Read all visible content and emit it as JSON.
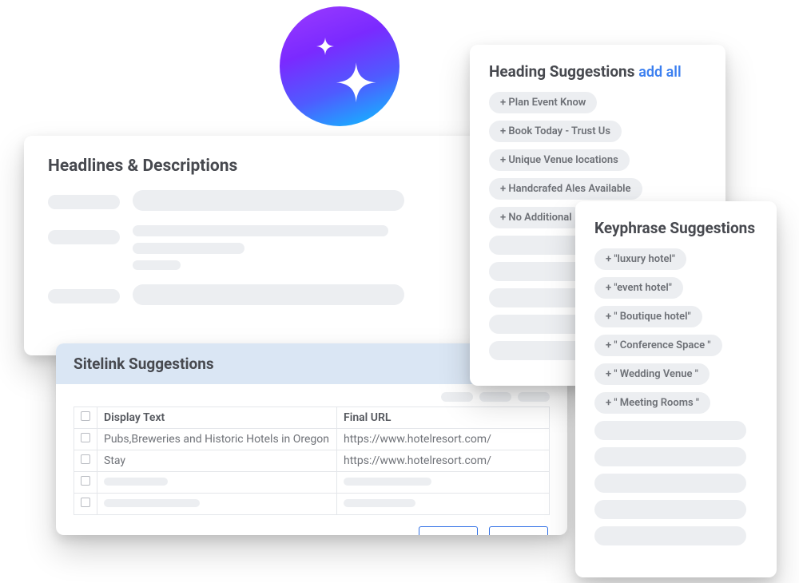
{
  "badge": {
    "icon": "sparkle-icon"
  },
  "headlines_card": {
    "title": "Headlines & Descriptions"
  },
  "sitelink_card": {
    "title": "Sitelink Suggestions",
    "columns": {
      "display_text": "Display Text",
      "final_url": "Final URL"
    },
    "rows": [
      {
        "display_text": "Pubs,Breweries and Historic Hotels in Oregon",
        "final_url": "https://www.hotelresort.com/"
      },
      {
        "display_text": "Stay",
        "final_url": "https://www.hotelresort.com/"
      }
    ]
  },
  "heading_suggestions": {
    "title": "Heading Suggestions",
    "add_all_label": "add all",
    "items": [
      "+ Plan Event Know",
      "+ Book Today - Trust Us",
      "+ Unique Venue locations",
      "+ Handcrafed Ales Available",
      "+ No Additional"
    ]
  },
  "keyphrase_suggestions": {
    "title": "Keyphrase Suggestions",
    "items": [
      "+ \"luxury hotel\"",
      "+ \"event hotel\"",
      "+ \" Boutique hotel\"",
      "+ \" Conference Space \"",
      "+ \" Wedding Venue \"",
      "+ \" Meeting Rooms \""
    ]
  }
}
